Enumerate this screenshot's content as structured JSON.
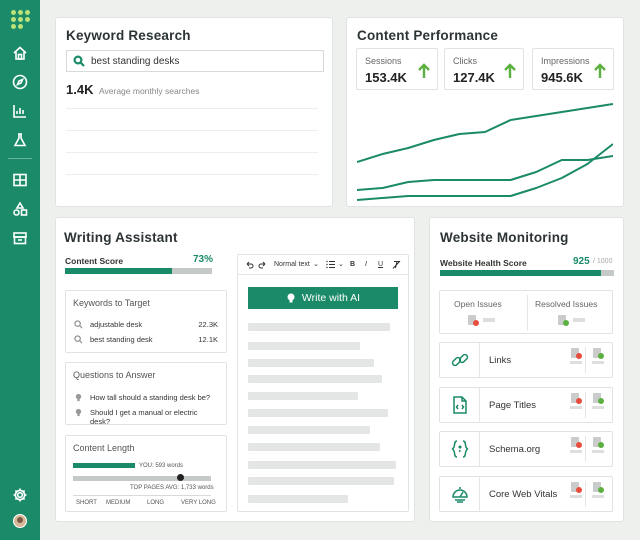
{
  "sidebar": {
    "logo": "dots-logo",
    "items": [
      {
        "icon": "home-icon"
      },
      {
        "icon": "compass-icon"
      },
      {
        "icon": "bar-chart-icon"
      },
      {
        "icon": "flask-icon"
      },
      {
        "icon": "table-icon"
      },
      {
        "icon": "shapes-icon"
      },
      {
        "icon": "archive-icon"
      }
    ],
    "settings_icon": "gear-icon",
    "avatar": "user-avatar"
  },
  "keyword_research": {
    "title": "Keyword Research",
    "search_value": "best standing desks",
    "volume": "1.4K",
    "volume_label": "Average monthly searches"
  },
  "content_performance": {
    "title": "Content Performance",
    "metrics": [
      {
        "label": "Sessions",
        "value": "153.4K",
        "trend": "up"
      },
      {
        "label": "Clicks",
        "value": "127.4K",
        "trend": "up"
      },
      {
        "label": "Impressions",
        "value": "945.6K",
        "trend": "up"
      }
    ]
  },
  "chart_data": {
    "type": "line",
    "title": "",
    "xlabel": "",
    "ylabel": "",
    "x": [
      0,
      1,
      2,
      3,
      4,
      5,
      6,
      7,
      8,
      9,
      10
    ],
    "series": [
      {
        "values": [
          20,
          24,
          27,
          31,
          34,
          35,
          41,
          43,
          45,
          47,
          49
        ]
      },
      {
        "values": [
          6,
          7,
          10,
          11,
          11,
          11,
          11,
          15,
          21,
          21,
          23
        ]
      },
      {
        "values": [
          1,
          2,
          3,
          3,
          3,
          3,
          3,
          7,
          12,
          19,
          29
        ]
      }
    ],
    "ylim": [
      0,
      52
    ],
    "grid": false,
    "legend": "none",
    "colors": [
      "#1a8a68",
      "#1a8a68",
      "#1a8a68"
    ]
  },
  "writing_assistant": {
    "title": "Writing Assistant",
    "score_label": "Content Score",
    "score_value": "73%",
    "score_fraction": 0.73,
    "keywords_title": "Keywords to Target",
    "keywords": [
      {
        "term": "adjustable desk",
        "volume": "22.3K"
      },
      {
        "term": "best standing desk",
        "volume": "12.1K"
      }
    ],
    "questions_title": "Questions to Answer",
    "questions": [
      {
        "text": "How tall should a standing desk be?"
      },
      {
        "text": "Should I get a manual or electric desk?"
      }
    ],
    "length_title": "Content Length",
    "you_label": "YOU: 593 words",
    "top_label": "TOP PAGES AVG: 1,733 words",
    "scale": [
      "SHORT",
      "MEDIUM",
      "LONG",
      "VERY LONG"
    ],
    "editor": {
      "undo_icon": "undo-icon",
      "redo_icon": "redo-icon",
      "style_select": "Normal text",
      "list_icon": "list-icon",
      "bold": "B",
      "italic": "I",
      "underline": "U",
      "clear_icon": "clear-format-icon",
      "ai_button": "Write with AI"
    }
  },
  "website_monitoring": {
    "title": "Website Monitoring",
    "health_label": "Website Health Score",
    "health_value": "925",
    "health_max": "/ 1000",
    "health_fraction": 0.925,
    "open_issues": "Open Issues",
    "resolved_issues": "Resolved Issues",
    "rows": [
      {
        "label": "Links",
        "icon": "link-icon"
      },
      {
        "label": "Page Titles",
        "icon": "document-code-icon"
      },
      {
        "label": "Schema.org",
        "icon": "braces-icon"
      },
      {
        "label": "Core Web Vitals",
        "icon": "speed-icon"
      }
    ],
    "status_colors": {
      "error": "#e74c3c",
      "ok": "#5bb040"
    }
  }
}
